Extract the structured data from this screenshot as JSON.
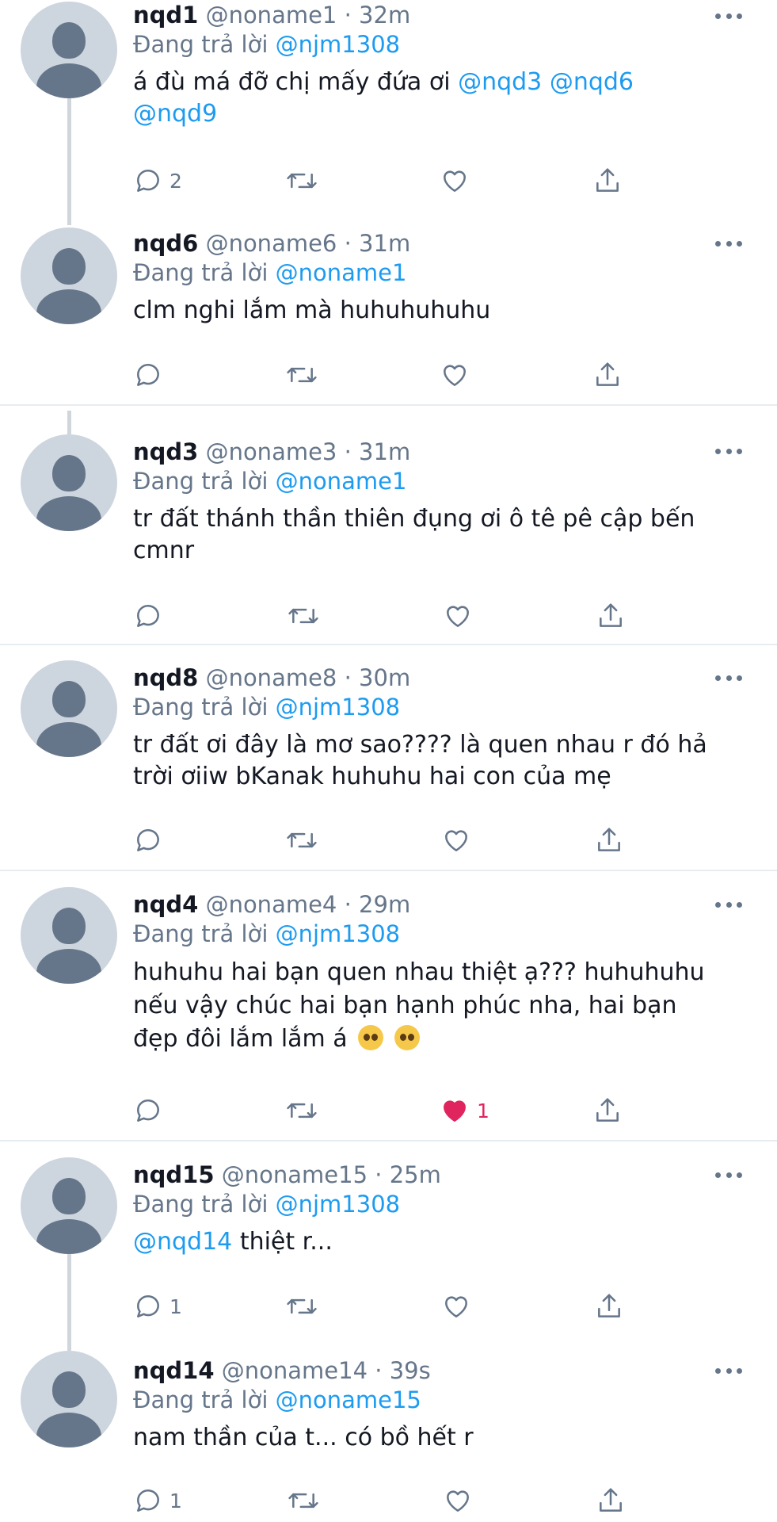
{
  "reply_prefix": "Đang trả lời",
  "tweets": [
    {
      "name": "nqd1",
      "handle": "@noname1",
      "time": "32m",
      "reply_to": "@njm1308",
      "text_parts": [
        "á đù má đỡ chị mấy đứa ơi ",
        "@nqd3",
        " ",
        "@nqd6",
        "@nqd9"
      ],
      "reply_count": "2",
      "like_count": ""
    },
    {
      "name": "nqd6",
      "handle": "@noname6",
      "time": "31m",
      "reply_to": "@noname1",
      "text": "clm nghi lắm mà huhuhuhuhu",
      "reply_count": "",
      "like_count": ""
    },
    {
      "name": "nqd3",
      "handle": "@noname3",
      "time": "31m",
      "reply_to": "@noname1",
      "text_lines": [
        "tr đất thánh thần thiên đụng ơi ô tê pê cập bến",
        "cmnr"
      ],
      "reply_count": "",
      "like_count": ""
    },
    {
      "name": "nqd8",
      "handle": "@noname8",
      "time": "30m",
      "reply_to": "@njm1308",
      "text_lines": [
        "tr đất ơi đây là mơ sao???? là quen nhau r đó hả",
        "trời ơiiw bKanak huhuhu hai con của mẹ"
      ],
      "reply_count": "",
      "like_count": ""
    },
    {
      "name": "nqd4",
      "handle": "@noname4",
      "time": "29m",
      "reply_to": "@njm1308",
      "text_lines": [
        "huhuhu hai bạn quen nhau thiệt ạ??? huhuhuhu",
        "nếu vậy chúc hai bạn hạnh phúc nha, hai bạn",
        "đẹp đôi lắm lắm á"
      ],
      "reply_count": "",
      "like_count": "1"
    },
    {
      "name": "nqd15",
      "handle": "@noname15",
      "time": "25m",
      "reply_to": "@njm1308",
      "text_parts": [
        "@nqd14",
        " thiệt r..."
      ],
      "reply_count": "1",
      "like_count": ""
    },
    {
      "name": "nqd14",
      "handle": "@noname14",
      "time": "39s",
      "reply_to": "@noname15",
      "text": "nam thần của t... có bồ hết r",
      "reply_count": "1",
      "like_count": ""
    }
  ],
  "colors": {
    "link": "#1d9bf0",
    "secondary": "#66768a",
    "like": "#e0245e",
    "avatar_bg": "#cdd5de"
  },
  "icons": [
    "reply-icon",
    "retweet-icon",
    "like-icon",
    "share-icon",
    "more-icon"
  ]
}
